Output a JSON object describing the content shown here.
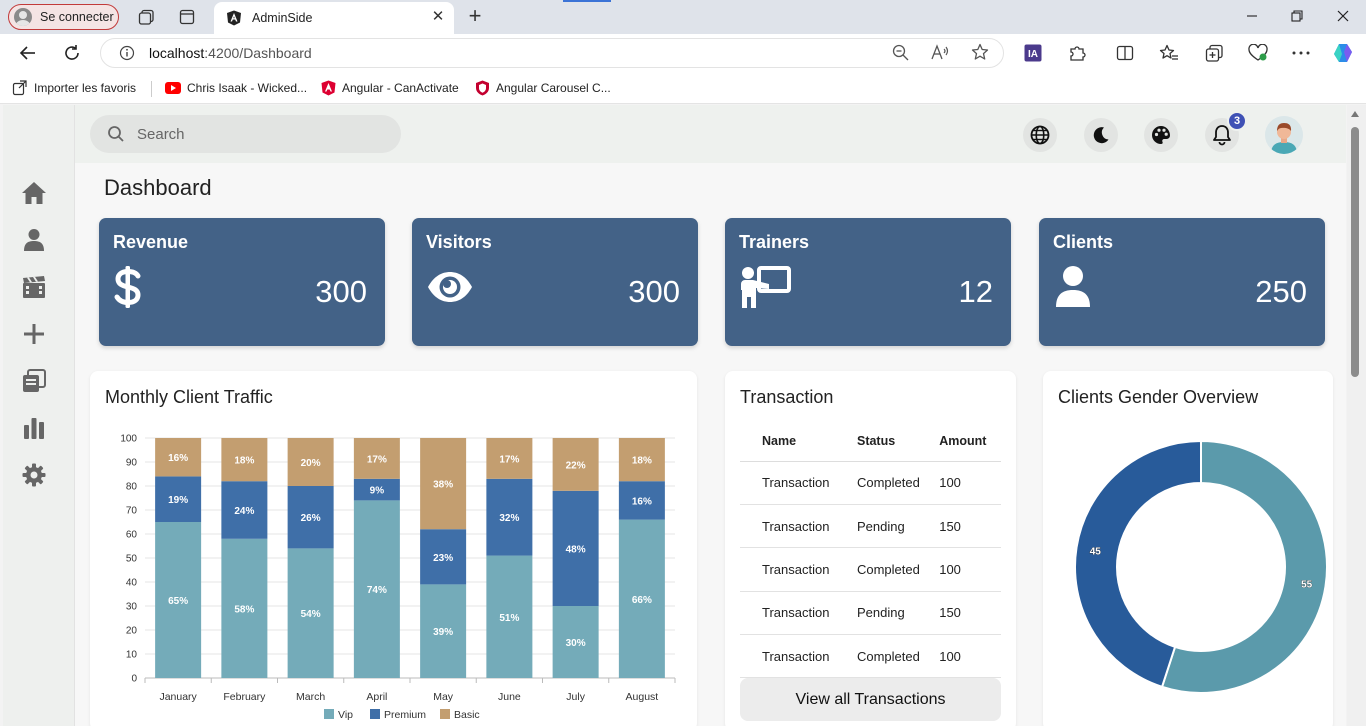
{
  "browser": {
    "profile_label": "Se connecter",
    "tab_title": "AdminSide",
    "url_host": "localhost",
    "url_path": ":4200/Dashboard",
    "bookmarks": [
      {
        "label": "Importer les favoris",
        "icon": "import-icon"
      },
      {
        "label": "Chris Isaak - Wicked...",
        "icon": "youtube-icon"
      },
      {
        "label": "Angular - CanActivate",
        "icon": "angular-icon"
      },
      {
        "label": "Angular Carousel C...",
        "icon": "shield-icon"
      }
    ],
    "extension_label": "IA"
  },
  "topbar": {
    "search_placeholder": "Search",
    "notification_count": "3"
  },
  "page": {
    "title": "Dashboard"
  },
  "stats": [
    {
      "label": "Revenue",
      "value": "300",
      "icon": "dollar-icon"
    },
    {
      "label": "Visitors",
      "value": "300",
      "icon": "eye-icon"
    },
    {
      "label": "Trainers",
      "value": "12",
      "icon": "trainer-icon"
    },
    {
      "label": "Clients",
      "value": "250",
      "icon": "user-icon"
    }
  ],
  "traffic": {
    "title": "Monthly Client Traffic"
  },
  "transactions": {
    "title": "Transaction",
    "headers": [
      "Name",
      "Status",
      "Amount"
    ],
    "rows": [
      [
        "Transaction",
        "Completed",
        "100"
      ],
      [
        "Transaction",
        "Pending",
        "150"
      ],
      [
        "Transaction",
        "Completed",
        "100"
      ],
      [
        "Transaction",
        "Pending",
        "150"
      ],
      [
        "Transaction",
        "Completed",
        "100"
      ]
    ],
    "button_label": "View all Transactions"
  },
  "gender": {
    "title": "Clients Gender Overview"
  },
  "chart_data": [
    {
      "type": "bar",
      "stacked": true,
      "title": "Monthly Client Traffic",
      "categories": [
        "January",
        "February",
        "March",
        "April",
        "May",
        "June",
        "July",
        "August"
      ],
      "series": [
        {
          "name": "Vip",
          "color": "#74abb9",
          "values": [
            65,
            58,
            54,
            74,
            39,
            51,
            30,
            66
          ]
        },
        {
          "name": "Premium",
          "color": "#3f6fa8",
          "values": [
            19,
            24,
            26,
            9,
            23,
            32,
            48,
            16
          ]
        },
        {
          "name": "Basic",
          "color": "#c39e70",
          "values": [
            16,
            18,
            20,
            17,
            38,
            17,
            22,
            18
          ]
        }
      ],
      "ylim": [
        0,
        100
      ],
      "yticks": [
        0,
        10,
        20,
        30,
        40,
        50,
        60,
        70,
        80,
        90,
        100
      ],
      "data_label_suffix": "%",
      "legend": "bottom",
      "grid": true
    },
    {
      "type": "pie",
      "donut": true,
      "title": "Clients Gender Overview",
      "slices": [
        {
          "value": 55,
          "color": "#5b9aab"
        },
        {
          "value": 45,
          "color": "#285b9a"
        }
      ]
    }
  ]
}
